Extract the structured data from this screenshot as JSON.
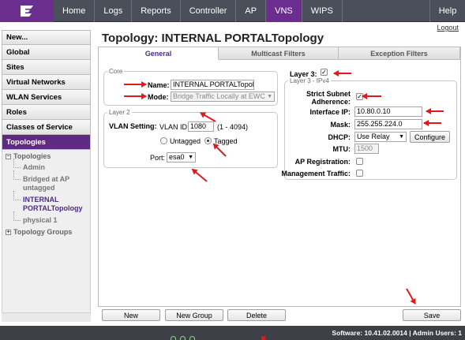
{
  "nav": {
    "items": [
      "Home",
      "Logs",
      "Reports",
      "Controller",
      "AP",
      "VNS",
      "WIPS"
    ],
    "active": "VNS",
    "help": "Help",
    "logout": "Logout"
  },
  "sidebar": {
    "items": [
      "New...",
      "Global",
      "Sites",
      "Virtual Networks",
      "WLAN Services",
      "Roles",
      "Classes of Service",
      "Topologies"
    ],
    "active": "Topologies",
    "tree": {
      "root": "Topologies",
      "children": [
        "Admin",
        "Bridged at AP untagged",
        "INTERNAL PORTALTopology",
        "physical 1"
      ],
      "groups": "Topology Groups"
    }
  },
  "page": {
    "title": "Topology: INTERNAL PORTALTopology"
  },
  "tabs": [
    "General",
    "Multicast Filters",
    "Exception Filters"
  ],
  "core": {
    "legend": "Core",
    "name_label": "Name:",
    "name_value": "INTERNAL PORTALTopology",
    "mode_label": "Mode:",
    "mode_value": "Bridge Traffic Locally at EWC"
  },
  "layer2": {
    "legend": "Layer 2",
    "vlan_setting_label": "VLAN Setting:",
    "vlan_id_label": "VLAN ID:",
    "vlan_id_value": "1080",
    "vlan_range": "(1 - 4094)",
    "untagged_label": "Untagged",
    "tagged_label": "Tagged",
    "tagged": true,
    "port_label": "Port:",
    "port_value": "esa0"
  },
  "layer3": {
    "label": "Layer 3:",
    "enabled": true,
    "legend": "Layer 3 - IPv4",
    "strict_label": "Strict Subnet Adherence:",
    "strict_checked": true,
    "interface_ip_label": "Interface IP:",
    "interface_ip_value": "10.80.0.10",
    "mask_label": "Mask:",
    "mask_value": "255.255.224.0",
    "dhcp_label": "DHCP:",
    "dhcp_value": "Use Relay",
    "configure_label": "Configure",
    "mtu_label": "MTU:",
    "mtu_value": "1500",
    "ap_registration_label": "AP Registration:",
    "management_traffic_label": "Management Traffic:"
  },
  "buttons": {
    "new": "New",
    "new_group": "New Group",
    "delete": "Delete",
    "save": "Save"
  },
  "footer": {
    "software": "Software: 10.41.02.0014 | Admin Users: 1"
  },
  "colors": {
    "accent": "#6b2d90",
    "annotation": "#e0191b",
    "nav_bg": "#4a4f5a"
  }
}
